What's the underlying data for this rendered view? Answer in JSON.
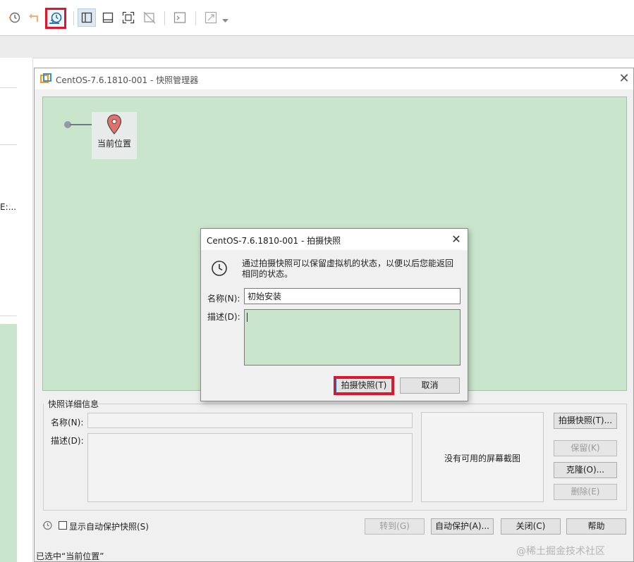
{
  "manager": {
    "title": "CentOS-7.6.1810-001 - 快照管理器",
    "current_position": "当前位置",
    "details_group": "快照详细信息",
    "name_label": "名称(N):",
    "desc_label": "描述(D):",
    "no_screenshot": "没有可用的屏幕截图",
    "buttons": {
      "take": "拍摄快照(T)...",
      "keep": "保留(K)",
      "clone": "克隆(O)...",
      "delete": "删除(E)",
      "goto": "转到(G)",
      "autoprotect": "自动保护(A)...",
      "close": "关闭(C)",
      "help": "帮助"
    },
    "show_autoprotect": "显示自动保护快照(S)",
    "status": "已选中“当前位置”"
  },
  "dialog": {
    "title": "CentOS-7.6.1810-001 - 拍摄快照",
    "message": "通过拍摄快照可以保留虚拟机的状态，以便以后您能返回相同的状态。",
    "name_label": "名称(N):",
    "name_value": "初始安装",
    "desc_label": "描述(D):",
    "desc_value": "",
    "take_button": "拍摄快照(T)",
    "cancel_button": "取消"
  },
  "background": {
    "truncated_text": "E:..."
  },
  "watermark": "@稀土掘金技术社区",
  "colors": {
    "tree_bg": "#c9e6cc",
    "highlight": "#d9182e",
    "pin": "#e2706b"
  }
}
